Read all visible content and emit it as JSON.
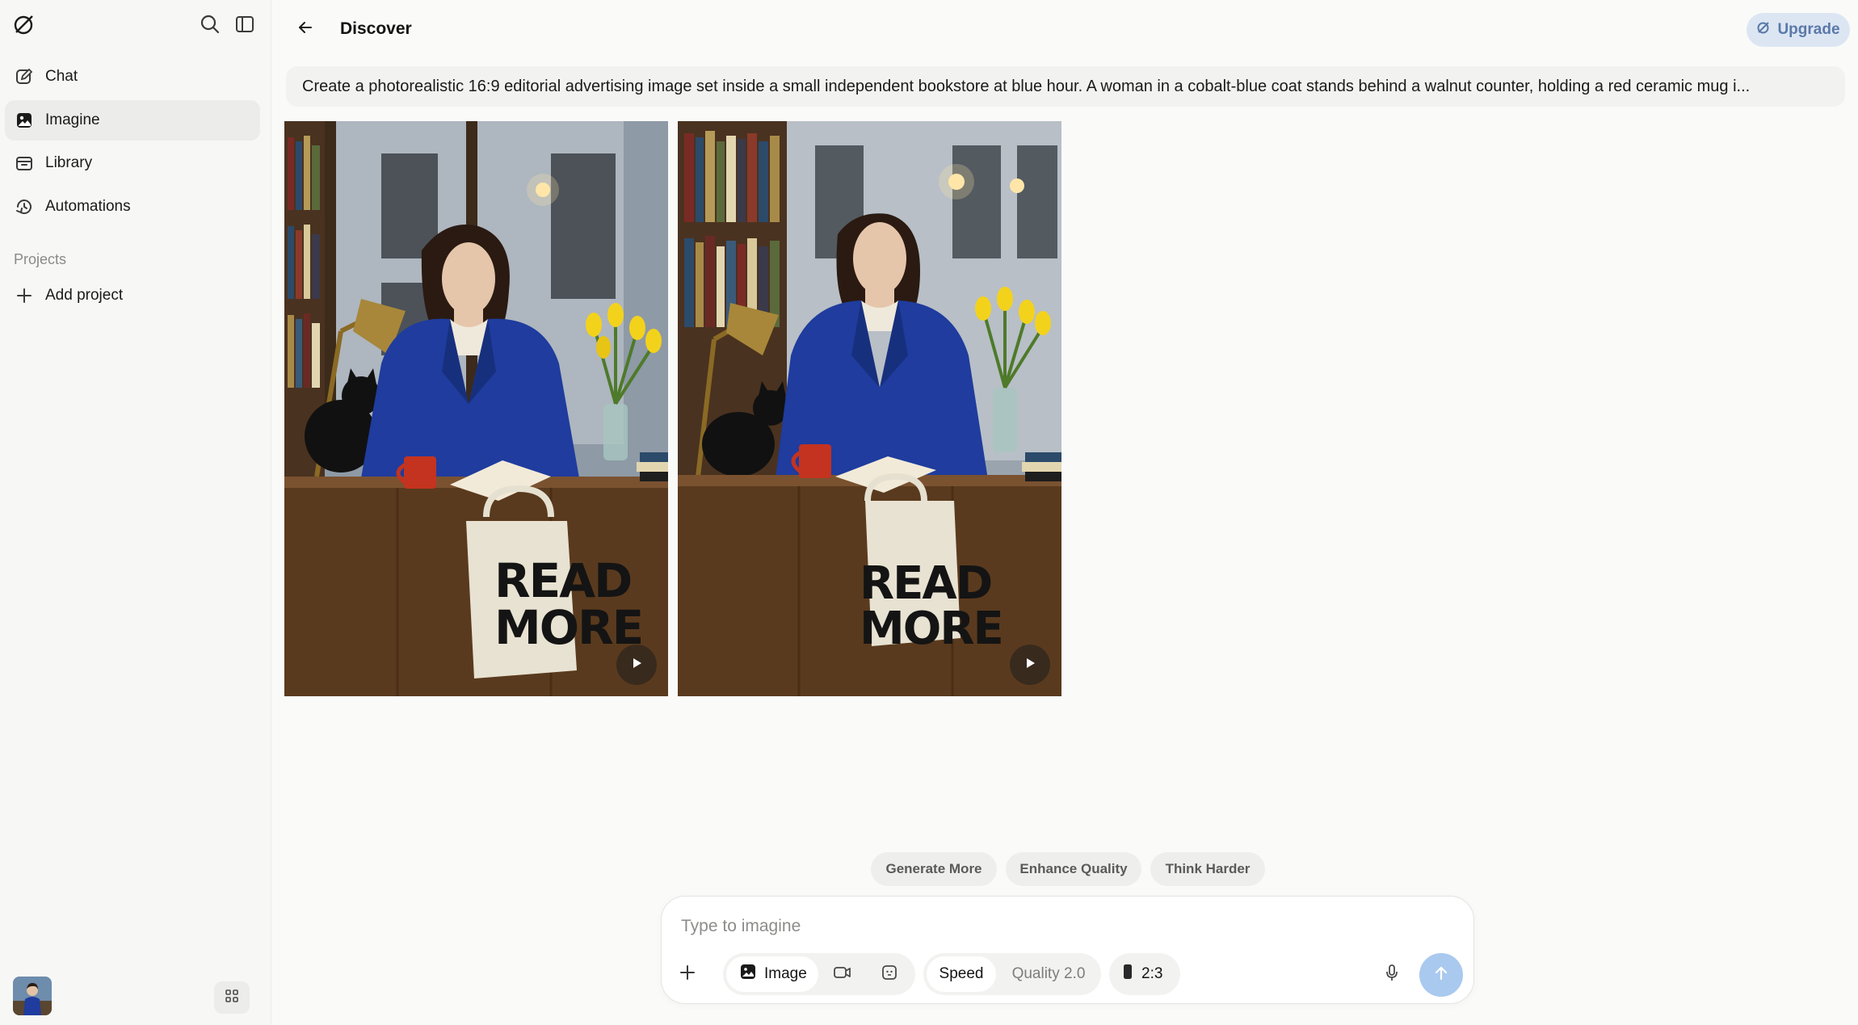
{
  "sidebar": {
    "logo_icon": "grok-logo-icon",
    "top_icons": [
      "search-icon",
      "sidebar-toggle-icon"
    ],
    "items": [
      {
        "label": "Chat",
        "icon": "edit-icon",
        "active": false
      },
      {
        "label": "Imagine",
        "icon": "imagine-icon",
        "active": true
      },
      {
        "label": "Library",
        "icon": "library-icon",
        "active": false
      },
      {
        "label": "Automations",
        "icon": "automations-icon",
        "active": false
      }
    ],
    "projects_label": "Projects",
    "add_project_label": "Add project",
    "bottom_icons": [
      "avatar",
      "apps-grid-icon"
    ]
  },
  "header": {
    "title": "Discover",
    "upgrade_label": "Upgrade"
  },
  "prompt": {
    "text": "Create a photorealistic 16:9 editorial advertising image set inside a small independent bookstore at blue hour. A woman in a cobalt-blue coat stands behind a walnut counter, holding a red ceramic mug i..."
  },
  "results": [
    {
      "bag_text_line1": "READ",
      "bag_text_line2": "MORE",
      "play_icon": "play-icon"
    },
    {
      "bag_text_line1": "READ",
      "bag_text_line2": "MORE",
      "play_icon": "play-icon"
    }
  ],
  "suggestions": [
    "Generate More",
    "Enhance Quality",
    "Think Harder"
  ],
  "composer": {
    "placeholder": "Type to imagine",
    "mode_image_label": "Image",
    "speed_label": "Speed",
    "quality_label": "Quality 2.0",
    "ratio_label": "2:3"
  },
  "colors": {
    "accent_send": "#a9c9ef",
    "upgrade_bg": "#dce6f3",
    "upgrade_text": "#5b79a8",
    "coat_blue": "#1f3c9e"
  }
}
